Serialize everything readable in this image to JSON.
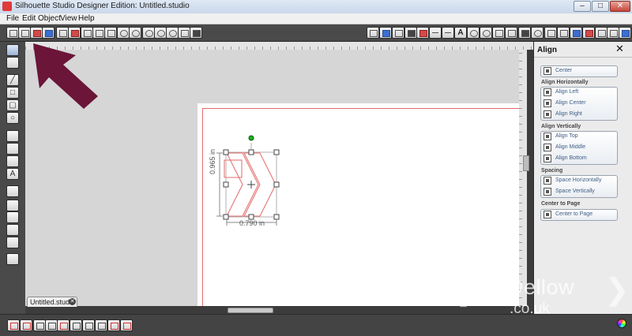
{
  "window": {
    "title": "Silhouette Studio Designer Edition: Untitled.studio",
    "min_glyph": "–",
    "max_glyph": "□",
    "close_glyph": "✕"
  },
  "menu": {
    "items": [
      "File",
      "Edit",
      "Object",
      "View",
      "Help"
    ]
  },
  "toolbar": {
    "text_tool_glyph": "A"
  },
  "left_tools": {
    "text_glyph": "A"
  },
  "canvas": {
    "dimension_height": "0.965 in",
    "dimension_width": "0.790 in"
  },
  "document_tab": {
    "label": "Untitled.studio",
    "close_glyph": "✕"
  },
  "align_panel": {
    "title": "Align",
    "close_glyph": "✕",
    "center_label": "Center",
    "horizontal": {
      "label": "Align Horizontally",
      "items": [
        "Align Left",
        "Align Center",
        "Align Right"
      ]
    },
    "vertical": {
      "label": "Align Vertically",
      "items": [
        "Align Top",
        "Align Middle",
        "Align Bottom"
      ]
    },
    "spacing": {
      "label": "Spacing",
      "items": [
        "Space Horizontally",
        "Space Vertically"
      ]
    },
    "page": {
      "label": "Center to Page",
      "items": [
        "Center to Page"
      ]
    }
  },
  "watermark": {
    "main": "Kim Dellow",
    "sub": ".co.uk"
  },
  "colors": {
    "arrow": "#6b1538",
    "cut_line": "#e36a6a",
    "selection_handle_rotate": "#19b319"
  },
  "icons": {
    "toolbar": [
      "new-document-icon",
      "open-icon",
      "save-icon",
      "save-to-library-icon",
      "print-icon",
      "print-cut-icon",
      "copy-icon",
      "paste-icon",
      "cut-icon",
      "undo-icon",
      "redo-icon",
      "zoom-in-icon",
      "zoom-out-icon",
      "zoom-select-icon",
      "pan-icon",
      "fit-page-icon"
    ],
    "left": [
      "select-icon",
      "point-edit-icon",
      "line-icon",
      "rectangle-icon",
      "rounded-rectangle-icon",
      "ellipse-icon",
      "polygon-icon",
      "curve-icon",
      "freehand-icon",
      "text-icon",
      "eraser-icon",
      "knife-icon"
    ]
  }
}
